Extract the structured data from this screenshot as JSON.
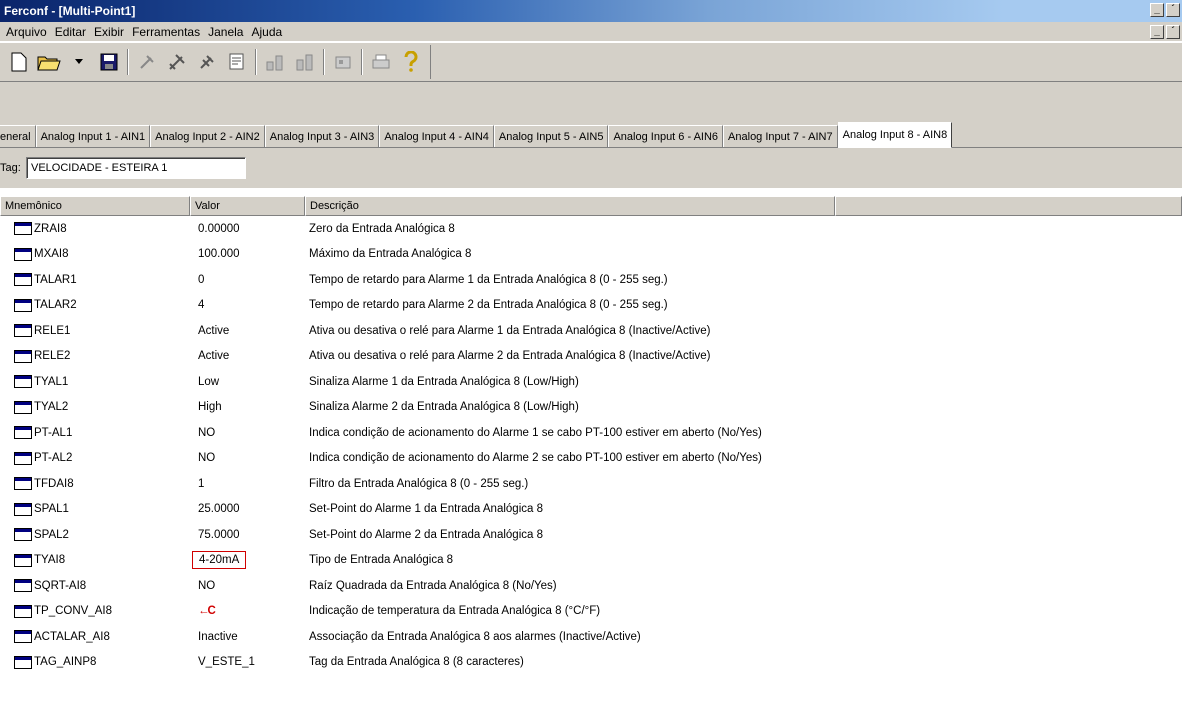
{
  "window": {
    "title": "Ferconf - [Multi-Point1]",
    "min_label": "_",
    "restore_label": "´"
  },
  "menu": [
    "Arquivo",
    "Editar",
    "Exibir",
    "Ferramentas",
    "Janela",
    "Ajuda"
  ],
  "toolbar": {
    "icons": [
      "new-file-icon",
      "open-folder-icon",
      "save-icon",
      "disconnect-icon",
      "connect-icon",
      "connect-alt-icon",
      "monitor-icon",
      "download-icon",
      "upload-icon",
      "module-icon",
      "print-icon",
      "help-icon"
    ]
  },
  "tabs": [
    "eneral",
    "Analog Input 1 - AIN1",
    "Analog Input 2 - AIN2",
    "Analog Input 3 - AIN3",
    "Analog Input 4 - AIN4",
    "Analog Input 5 - AIN5",
    "Analog Input 6 - AIN6",
    "Analog Input 7 - AIN7",
    "Analog Input 8 - AIN8"
  ],
  "active_tab": "Analog Input 8 - AIN8",
  "tag": {
    "label": "Tag:",
    "value": "VELOCIDADE - ESTEIRA 1"
  },
  "table": {
    "headers": [
      "Mnemônico",
      "Valor",
      "Descrição"
    ],
    "rows": [
      {
        "mnemonic": "ZRAI8",
        "value": "0.00000",
        "description": "Zero da Entrada Analógica 8"
      },
      {
        "mnemonic": "MXAI8",
        "value": "100.000",
        "description": "Máximo da Entrada Analógica 8"
      },
      {
        "mnemonic": "TALAR1",
        "value": "0",
        "description": "Tempo de retardo para Alarme 1 da Entrada Analógica 8 (0 - 255 seg.)"
      },
      {
        "mnemonic": "TALAR2",
        "value": "4",
        "description": "Tempo de retardo para Alarme 2 da Entrada Analógica 8 (0 - 255 seg.)"
      },
      {
        "mnemonic": "RELE1",
        "value": "Active",
        "description": "Ativa ou desativa o relé para Alarme 1 da Entrada Analógica 8 (Inactive/Active)"
      },
      {
        "mnemonic": "RELE2",
        "value": "Active",
        "description": "Ativa ou desativa o relé para Alarme 2 da Entrada Analógica 8 (Inactive/Active)"
      },
      {
        "mnemonic": "TYAL1",
        "value": "Low",
        "description": "Sinaliza Alarme 1 da Entrada Analógica 8 (Low/High)"
      },
      {
        "mnemonic": "TYAL2",
        "value": "High",
        "description": "Sinaliza Alarme 2 da Entrada Analógica 8 (Low/High)"
      },
      {
        "mnemonic": "PT-AL1",
        "value": "NO",
        "description": "Indica condição de acionamento do Alarme 1 se cabo PT-100 estiver em aberto (No/Yes)"
      },
      {
        "mnemonic": "PT-AL2",
        "value": "NO",
        "description": "Indica condição de acionamento do Alarme 2 se cabo PT-100 estiver em aberto (No/Yes)"
      },
      {
        "mnemonic": "TFDAI8",
        "value": "1",
        "description": "Filtro da Entrada Analógica 8 (0 - 255 seg.)"
      },
      {
        "mnemonic": "SPAL1",
        "value": "25.0000",
        "description": "Set-Point do Alarme 1 da Entrada Analógica 8"
      },
      {
        "mnemonic": "SPAL2",
        "value": "75.0000",
        "description": "Set-Point do Alarme 2 da Entrada Analógica 8"
      },
      {
        "mnemonic": "TYAI8",
        "value": "4-20mA",
        "description": "Tipo de Entrada Analógica 8"
      },
      {
        "mnemonic": "SQRT-AI8",
        "value": "NO",
        "description": "Raíz Quadrada da Entrada Analógica 8 (No/Yes)"
      },
      {
        "mnemonic": "TP_CONV_AI8",
        "value": "←C",
        "description": "Indicação de temperatura da Entrada Analógica 8 (°C/°F)"
      },
      {
        "mnemonic": "ACTALAR_AI8",
        "value": "Inactive",
        "description": "Associação da Entrada Analógica 8 aos alarmes (Inactive/Active)"
      },
      {
        "mnemonic": "TAG_AINP8",
        "value": "V_ESTE_1",
        "description": "Tag da Entrada Analógica 8 (8 caracteres)"
      }
    ]
  },
  "annotations": {
    "highlighted_value": "4-20mA",
    "highlight_color": "#d00000"
  }
}
